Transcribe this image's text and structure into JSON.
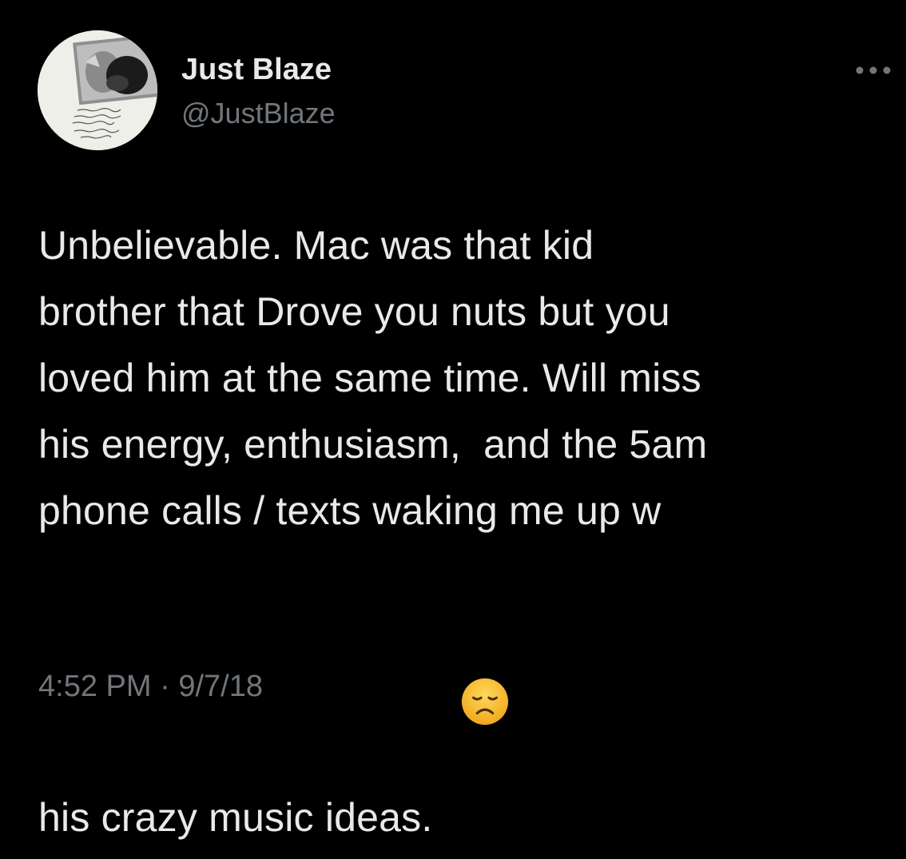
{
  "user": {
    "display_name": "Just Blaze",
    "handle": "@JustBlaze",
    "avatar_icon": "profile-photo-avatar"
  },
  "menu": {
    "more_icon": "more-horizontal-icon"
  },
  "tweet": {
    "lines": [
      "Unbelievable. Mac was that kid",
      "brother that Drove you nuts but you",
      "loved him at the same time. Will miss",
      "his energy, enthusiasm,  and the 5am",
      "phone calls / texts waking me up w",
      "his crazy music ideas.  "
    ],
    "emoji": "disappointed-face-emoji"
  },
  "meta": {
    "time": "4:52 PM",
    "separator": " · ",
    "date": "9/7/18"
  },
  "colors": {
    "background": "#000000",
    "primary_text": "#e7e9ea",
    "secondary_text": "#71767b"
  }
}
